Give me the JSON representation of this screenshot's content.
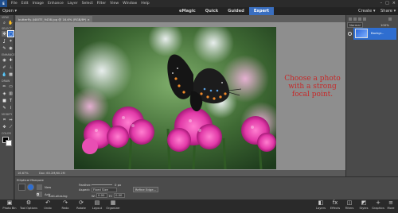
{
  "menubar": {
    "app_letter": "E",
    "items": [
      "File",
      "Edit",
      "Image",
      "Enhance",
      "Layer",
      "Select",
      "Filter",
      "View",
      "Window",
      "Help"
    ],
    "min": "–",
    "max": "□",
    "close": "×"
  },
  "modebar": {
    "open": "Open ▾",
    "modes": [
      {
        "label": "eMagic"
      },
      {
        "label": "Quick"
      },
      {
        "label": "Guided"
      },
      {
        "label": "Expert",
        "active": true
      }
    ],
    "create": "Create ▾",
    "share": "Share ▾"
  },
  "toolbox": {
    "sections": [
      "VIEW",
      "SELECT",
      "ENHANCE",
      "DRAW",
      "MODIFY",
      "COLOR"
    ]
  },
  "document": {
    "tab": "butterfly-IJ48ITE_9438.jpg @ 16.6% (RGB/8*) ×"
  },
  "overlay": {
    "text": "Choose a photo with a strong focal point."
  },
  "status": {
    "zoom": "16.67%",
    "doc": "Doc: 60.2M/60.2M"
  },
  "options": {
    "title": "Elliptical Marquee",
    "new": "New",
    "add": "Add",
    "feather": "Feather:",
    "feather_value": "0 px",
    "aspect_label": "Aspect:",
    "aspect_value": "Fixed Size",
    "w_label": "W:",
    "w_value": "0.00",
    "h_label": "H:",
    "h_value": "0.00",
    "anti_alias": "Anti-aliasing",
    "refine": "Refine Edge..."
  },
  "layers": {
    "blend": "Normal",
    "opacity": "100%",
    "layer_name": "Backgr..."
  },
  "bottombar": {
    "left": [
      {
        "icon": "▣",
        "label": "Photo Bin"
      },
      {
        "icon": "⚙",
        "label": "Tool Options"
      },
      {
        "icon": "↶",
        "label": "Undo"
      },
      {
        "icon": "↷",
        "label": "Redo"
      },
      {
        "icon": "⟳",
        "label": "Rotate"
      },
      {
        "icon": "▤",
        "label": "Layout"
      },
      {
        "icon": "▦",
        "label": "Organizer"
      }
    ],
    "right": [
      {
        "icon": "◧",
        "label": "Layers"
      },
      {
        "icon": "fx",
        "label": "Effects"
      },
      {
        "icon": "◫",
        "label": "Filters"
      },
      {
        "icon": "◩",
        "label": "Styles"
      },
      {
        "icon": "+",
        "label": "Graphics"
      },
      {
        "icon": "≡",
        "label": "More"
      }
    ]
  },
  "colors": {
    "accent": "#3a6fc0",
    "overlay_text": "#c62a2a",
    "flower": "#e23aa8"
  }
}
